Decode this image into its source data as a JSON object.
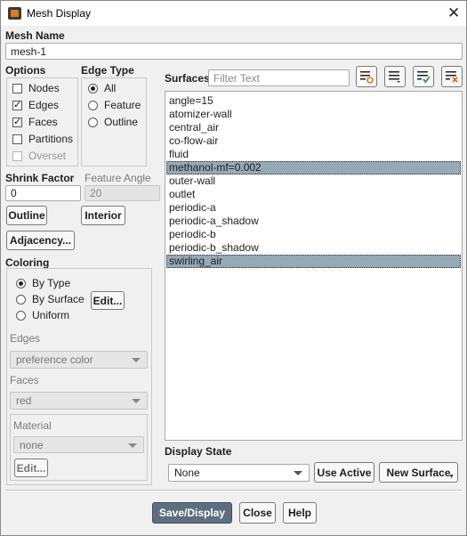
{
  "window": {
    "title": "Mesh Display"
  },
  "mesh_name": {
    "label": "Mesh Name",
    "value": "mesh-1"
  },
  "options": {
    "label": "Options",
    "items": [
      {
        "label": "Nodes",
        "checked": false,
        "disabled": false
      },
      {
        "label": "Edges",
        "checked": true,
        "disabled": false
      },
      {
        "label": "Faces",
        "checked": true,
        "disabled": false
      },
      {
        "label": "Partitions",
        "checked": false,
        "disabled": false
      },
      {
        "label": "Overset",
        "checked": false,
        "disabled": true
      }
    ]
  },
  "edge_type": {
    "label": "Edge Type",
    "items": [
      {
        "label": "All",
        "selected": true
      },
      {
        "label": "Feature",
        "selected": false
      },
      {
        "label": "Outline",
        "selected": false
      }
    ]
  },
  "shrink_factor": {
    "label": "Shrink Factor",
    "value": "0"
  },
  "feature_angle": {
    "label": "Feature Angle",
    "value": "20"
  },
  "buttons": {
    "outline": "Outline",
    "interior": "Interior",
    "adjacency": "Adjacency...",
    "coloring_edit": "Edit...",
    "material_edit": "Edit...",
    "use_active": "Use Active",
    "new_surface": "New Surface",
    "save_display": "Save/Display",
    "close": "Close",
    "help": "Help"
  },
  "coloring": {
    "label": "Coloring",
    "items": [
      {
        "label": "By Type",
        "selected": true
      },
      {
        "label": "By Surface",
        "selected": false
      },
      {
        "label": "Uniform",
        "selected": false
      }
    ],
    "edges_label": "Edges",
    "edges_value": "preference color",
    "faces_label": "Faces",
    "faces_value": "red",
    "material_label": "Material",
    "material_value": "none"
  },
  "surfaces": {
    "label": "Surfaces",
    "filter_placeholder": "Filter Text",
    "items": [
      {
        "label": "angle=15",
        "selected": false
      },
      {
        "label": "atomizer-wall",
        "selected": false
      },
      {
        "label": "central_air",
        "selected": false
      },
      {
        "label": "co-flow-air",
        "selected": false
      },
      {
        "label": "fluid",
        "selected": false
      },
      {
        "label": "methanol-mf=0.002",
        "selected": true
      },
      {
        "label": "outer-wall",
        "selected": false
      },
      {
        "label": "outlet",
        "selected": false
      },
      {
        "label": "periodic-a",
        "selected": false
      },
      {
        "label": "periodic-a_shadow",
        "selected": false
      },
      {
        "label": "periodic-b",
        "selected": false
      },
      {
        "label": "periodic-b_shadow",
        "selected": false
      },
      {
        "label": "swirling_air",
        "selected": true
      }
    ]
  },
  "display_state": {
    "label": "Display State",
    "value": "None"
  },
  "colors": {
    "selection": "#97a8b7",
    "primary_button": "#5e6e80",
    "icon_accent": "#e07a1f",
    "check_accent": "#2e9e3e",
    "clear_accent": "#d2691e"
  }
}
